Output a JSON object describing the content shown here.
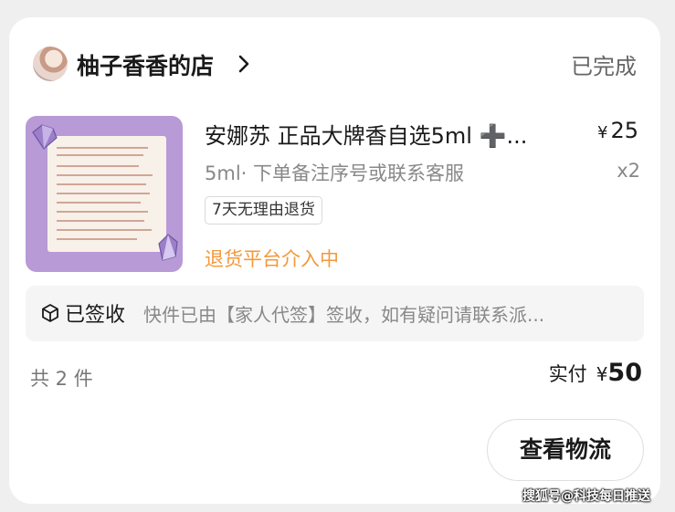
{
  "shop": {
    "name": "柚子香香的店",
    "status": "已完成"
  },
  "product": {
    "title": "安娜苏 正品大牌香自选5ml ➕...",
    "price_symbol": "¥",
    "price": "25",
    "spec": "5ml· 下单备注序号或联系客服",
    "quantity": "x2",
    "tag": "7天无理由退货",
    "refund_status": "退货平台介入中"
  },
  "logistics": {
    "status": "已签收",
    "description": "快件已由【家人代签】签收，如有疑问请联系派..."
  },
  "summary": {
    "count": "共 2 件",
    "paid_label": "实付",
    "paid_symbol": "¥",
    "paid_amount": "50"
  },
  "actions": {
    "view_logistics": "查看物流"
  },
  "watermark": "搜狐号@科技每日推送",
  "colors": {
    "refund_orange": "#f2993c",
    "thumb_purple": "#b89ad6",
    "muted_gray": "#888888"
  },
  "icons": {
    "header_chevron": "chevron-right-icon",
    "package": "package-box-icon"
  }
}
